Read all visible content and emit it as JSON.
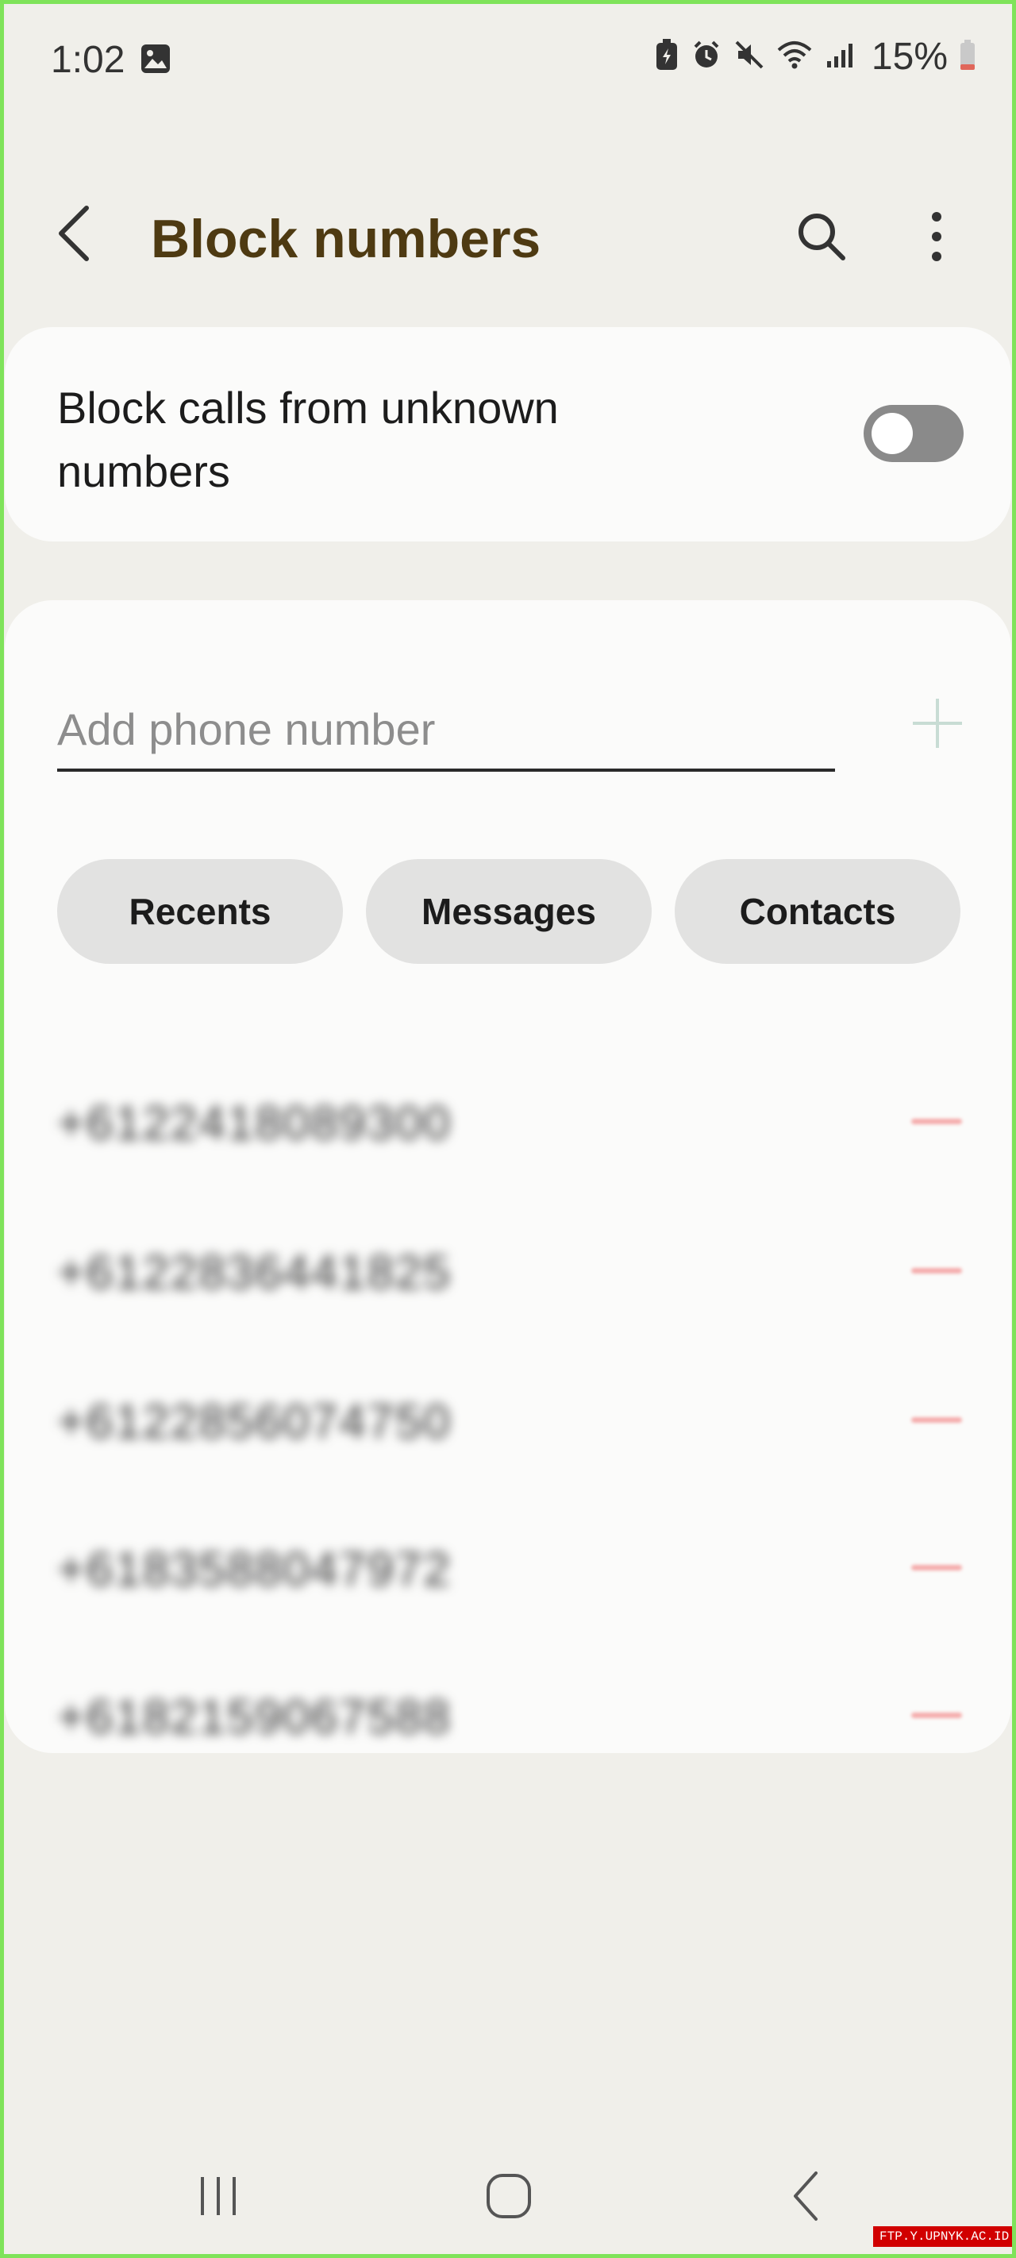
{
  "status_bar": {
    "time": "1:02",
    "battery": "15%",
    "icons": [
      "gallery-icon",
      "battery-saver-icon",
      "alarm-icon",
      "mute-icon",
      "wifi-icon",
      "signal-icon",
      "battery-icon"
    ]
  },
  "header": {
    "title": "Block numbers",
    "icons": [
      "back-arrow-icon",
      "search-icon",
      "more-vertical-icon"
    ]
  },
  "unknown_setting": {
    "label": "Block calls from unknown numbers",
    "toggle_on": false
  },
  "add_number": {
    "placeholder": "Add phone number",
    "add_icon": "plus-icon"
  },
  "chips": [
    {
      "label": "Recents"
    },
    {
      "label": "Messages"
    },
    {
      "label": "Contacts"
    }
  ],
  "blocked_numbers": [
    {
      "number": "+6122418089300"
    },
    {
      "number": "+6122836441825"
    },
    {
      "number": "+6122856074750"
    },
    {
      "number": "+6183588047972"
    },
    {
      "number": "+6182159067588"
    }
  ],
  "nav_bar": {
    "icons": [
      "recent-apps-icon",
      "home-icon",
      "back-icon"
    ]
  },
  "watermark": "FTP.Y.UPNYK.AC.ID",
  "colors": {
    "background": "#f0efea",
    "card": "#fbfbfa",
    "title": "#4e3a12",
    "chip": "#e2e2e1",
    "remove": "#ef6b6b",
    "frame": "#7fe35a"
  }
}
